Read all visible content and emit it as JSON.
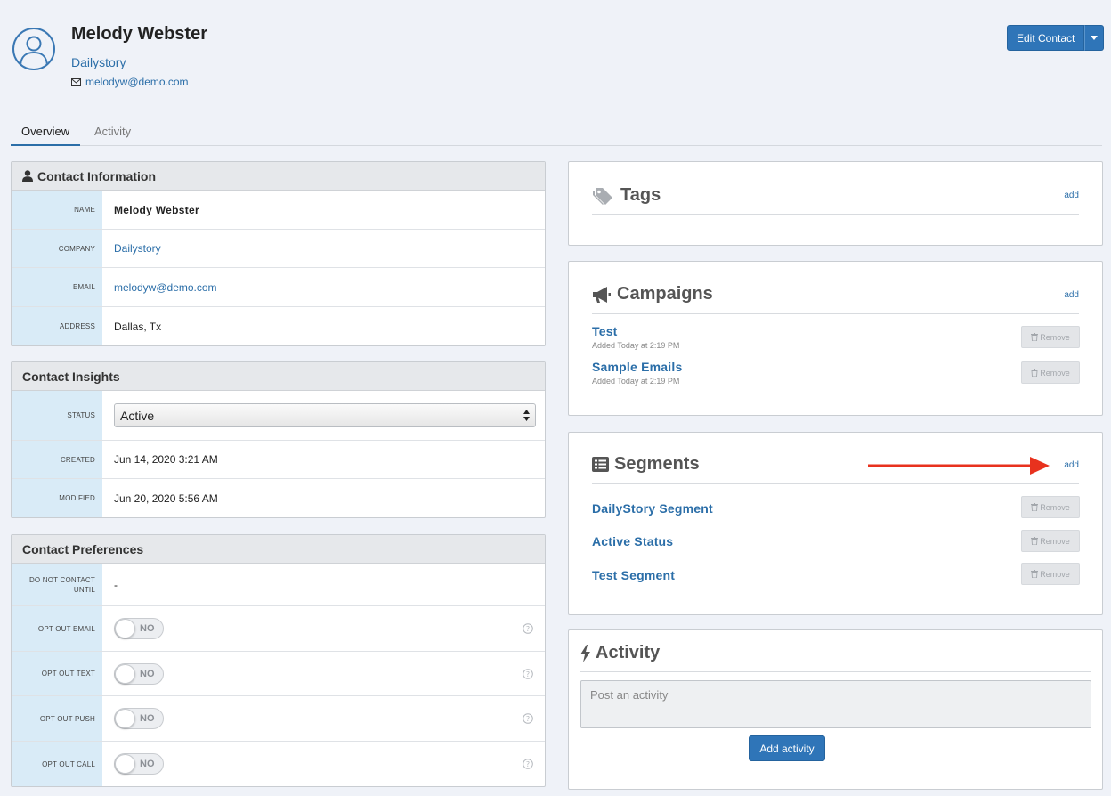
{
  "header": {
    "name": "Melody Webster",
    "company": "Dailystory",
    "email": "melodyw@demo.com",
    "edit_button": "Edit Contact"
  },
  "tabs": [
    {
      "label": "Overview",
      "active": true
    },
    {
      "label": "Activity",
      "active": false
    }
  ],
  "contact_information": {
    "title": "Contact Information",
    "rows": [
      {
        "label": "NAME",
        "value": "Melody Webster"
      },
      {
        "label": "COMPANY",
        "value": "Dailystory"
      },
      {
        "label": "EMAIL",
        "value": "melodyw@demo.com"
      },
      {
        "label": "ADDRESS",
        "value": "Dallas, Tx"
      }
    ]
  },
  "contact_insights": {
    "title": "Contact Insights",
    "status_label": "STATUS",
    "status_value": "Active",
    "created_label": "CREATED",
    "created_value": "Jun 14, 2020 3:21 AM",
    "modified_label": "MODIFIED",
    "modified_value": "Jun 20, 2020 5:56 AM"
  },
  "contact_preferences": {
    "title": "Contact Preferences",
    "do_not_contact_label": "DO NOT CONTACT UNTIL",
    "do_not_contact_value": "-",
    "toggles": [
      {
        "label": "OPT OUT EMAIL",
        "state": "NO"
      },
      {
        "label": "OPT OUT TEXT",
        "state": "NO"
      },
      {
        "label": "OPT OUT PUSH",
        "state": "NO"
      },
      {
        "label": "OPT OUT CALL",
        "state": "NO"
      }
    ]
  },
  "tags": {
    "title": "Tags",
    "add": "add"
  },
  "campaigns": {
    "title": "Campaigns",
    "add": "add",
    "items": [
      {
        "name": "Test",
        "added": "Added Today at 2:19 PM",
        "remove": "Remove"
      },
      {
        "name": "Sample Emails",
        "added": "Added Today at 2:19 PM",
        "remove": "Remove"
      }
    ]
  },
  "segments": {
    "title": "Segments",
    "add": "add",
    "items": [
      {
        "name": "DailyStory Segment",
        "remove": "Remove"
      },
      {
        "name": "Active Status",
        "remove": "Remove"
      },
      {
        "name": "Test Segment",
        "remove": "Remove"
      }
    ]
  },
  "activity": {
    "title": "Activity",
    "placeholder": "Post an activity",
    "button": "Add activity"
  },
  "colors": {
    "accent": "#2f75b8",
    "link": "#2b6ea8",
    "label_bg": "#d9ebf7",
    "page_bg": "#eff2f8",
    "annotation_arrow": "#e8321e"
  }
}
